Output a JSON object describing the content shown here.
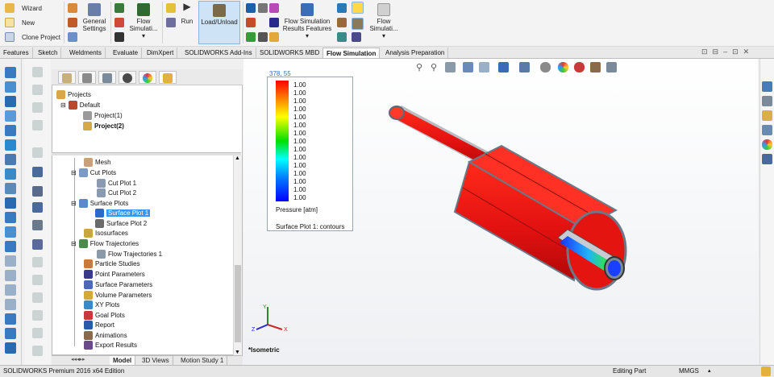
{
  "ribbon": {
    "wizard": "Wizard",
    "new": "New",
    "clone_project": "Clone Project",
    "general_settings": "General Settings",
    "flow_simulation_1": "Flow Simulati...",
    "run": "Run",
    "load_unload": "Load/Unload",
    "results_features": "Flow Simulation Results Features",
    "flow_simulation_2": "Flow Simulati..."
  },
  "command_tabs": [
    "Features",
    "Sketch",
    "Weldments",
    "Evaluate",
    "DimXpert",
    "SOLIDWORKS Add-Ins",
    "SOLIDWORKS MBD",
    "Flow Simulation",
    "Analysis Preparation"
  ],
  "active_tab": "Flow Simulation",
  "tree_top": {
    "projects": "Projects",
    "default": "Default",
    "project1": "Project(1)",
    "project2": "Project(2)"
  },
  "tree": {
    "mesh": "Mesh",
    "cut_plots": "Cut Plots",
    "cut_plot_1": "Cut Plot 1",
    "cut_plot_2": "Cut Plot 2",
    "surface_plots": "Surface Plots",
    "surface_plot_1": "Surface Plot 1",
    "surface_plot_2": "Surface Plot 2",
    "isosurfaces": "Isosurfaces",
    "flow_trajectories": "Flow Trajectories",
    "flow_trajectories_1": "Flow Trajectories 1",
    "particle_studies": "Particle Studies",
    "point_parameters": "Point Parameters",
    "surface_parameters": "Surface Parameters",
    "volume_parameters": "Volume Parameters",
    "xy_plots": "XY Plots",
    "goal_plots": "Goal Plots",
    "report": "Report",
    "animations": "Animations",
    "export_results": "Export Results"
  },
  "bottom_tabs": [
    "Model",
    "3D Views",
    "Motion Study 1"
  ],
  "legend": {
    "coords": "378, 55",
    "values": [
      "1.00",
      "1.00",
      "1.00",
      "1.00",
      "1.00",
      "1.00",
      "1.00",
      "1.00",
      "1.00",
      "1.00",
      "1.00",
      "1.00",
      "1.00",
      "1.00",
      "1.00"
    ],
    "title": "Pressure [atm]",
    "subtitle": "Surface Plot 1: contours"
  },
  "view_label": "*Isometric",
  "status": {
    "edition": "SOLIDWORKS Premium 2016 x64 Edition",
    "mode": "Editing Part",
    "units": "MMGS"
  }
}
